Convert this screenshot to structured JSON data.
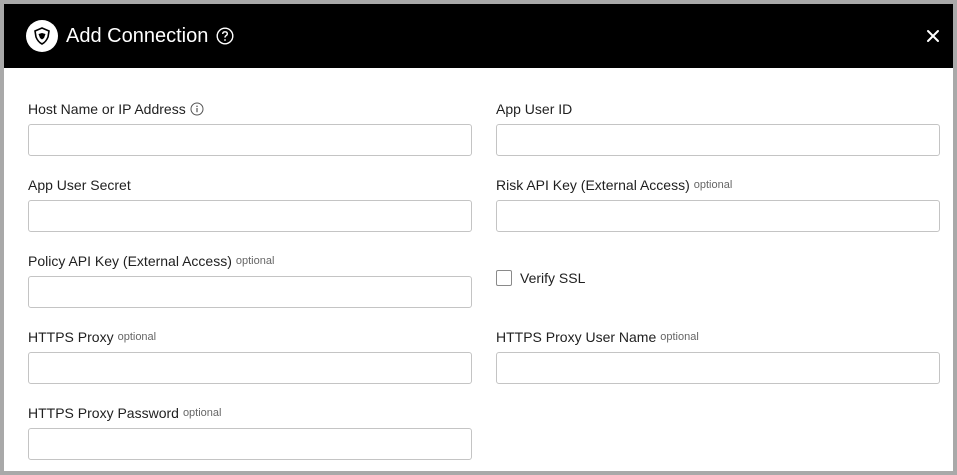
{
  "dialog": {
    "title": "Add Connection"
  },
  "fields": {
    "host": {
      "label": "Host Name or IP Address",
      "optional": "",
      "value": "",
      "placeholder": ""
    },
    "app_user_id": {
      "label": "App User ID",
      "optional": "",
      "value": "",
      "placeholder": ""
    },
    "app_user_secret": {
      "label": "App User Secret",
      "optional": "",
      "value": "",
      "placeholder": ""
    },
    "risk_api_key": {
      "label": "Risk API Key (External Access)",
      "optional": "optional",
      "value": "",
      "placeholder": ""
    },
    "policy_api_key": {
      "label": "Policy API Key (External Access)",
      "optional": "optional",
      "value": "",
      "placeholder": ""
    },
    "https_proxy": {
      "label": "HTTPS Proxy",
      "optional": "optional",
      "value": "",
      "placeholder": ""
    },
    "https_proxy_user": {
      "label": "HTTPS Proxy User Name",
      "optional": "optional",
      "value": "",
      "placeholder": ""
    },
    "https_proxy_password": {
      "label": "HTTPS Proxy Password",
      "optional": "optional",
      "value": "",
      "placeholder": ""
    }
  },
  "verify_ssl": {
    "label": "Verify SSL",
    "checked": false
  },
  "icons": {
    "logo": "shield-logo-icon",
    "help": "help-circle-icon",
    "close": "close-icon",
    "info": "info-icon"
  },
  "colors": {
    "header_bg": "#000000",
    "header_text": "#ffffff",
    "border": "#c4c4c4",
    "optional_text": "#666666"
  }
}
